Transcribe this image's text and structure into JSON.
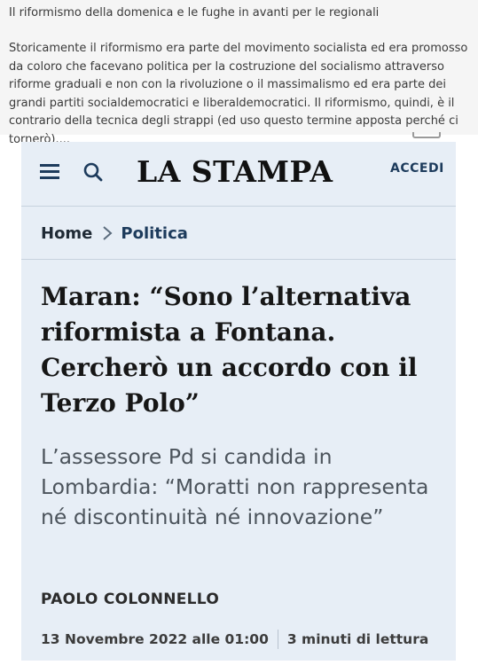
{
  "post": {
    "title": "Il riformismo della domenica e le fughe in avanti per le regionali",
    "body": "Storicamente il riformismo era parte del movimento socialista ed era promosso da coloro che facevano politica per la costruzione del socialismo attraverso riforme graduali e non con la rivoluzione o il massimalismo ed era parte dei grandi partiti socialdemocratici e liberaldemocratici. Il riformismo, quindi, è il contrario della tecnica degli strappi (ed uso questo termine apposta perché ci tornerò)...."
  },
  "article_card": {
    "header": {
      "logo": "LA STAMPA",
      "login_label": "ACCEDI"
    },
    "breadcrumb": {
      "home": "Home",
      "section": "Politica"
    },
    "headline": "Maran: “Sono l’alternativa riformista a Fontana. Cercherò un accordo con il Terzo Polo”",
    "subtitle": "L’assessore Pd si candida in Lombardia: “Moratti non rappresenta né discontinuità né innovazione”",
    "author": "PAOLO COLONNELLO",
    "date": "13 Novembre 2022 alle 01:00",
    "reading_time": "3 minuti di lettura"
  },
  "colors": {
    "card_background": "#e7eef6",
    "brand_navy": "#1d3b5c",
    "post_background": "#f5f5f5"
  }
}
